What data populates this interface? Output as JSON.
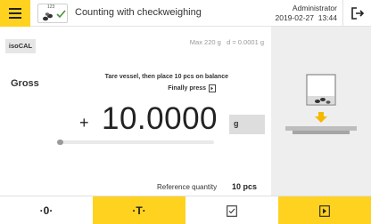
{
  "header": {
    "app_title": "Counting with checkweighing",
    "app_icon_superscript": "123",
    "user": "Administrator",
    "date": "2019-02-27",
    "time": "13:44"
  },
  "main": {
    "isocal_label": "isoCAL",
    "max_label": "Max 220 g",
    "d_label": "d = 0.0001 g",
    "mode": "Gross",
    "instruction_line1": "Tare vessel, then place 10 pcs on balance",
    "instruction_line2": "Finally press",
    "sign": "+",
    "weight_value": "10.0000",
    "unit": "g",
    "reference_label": "Reference quantity",
    "reference_value": "10 pcs"
  },
  "footer": {
    "zero_label": "·0·",
    "tare_label": "·T·"
  },
  "colors": {
    "accent": "#ffd21f",
    "side_panel": "#eeeeee",
    "arrow": "#f5b800"
  },
  "icons": {
    "menu": "hamburger-icon",
    "app": "counting-app-icon",
    "logout": "logout-icon",
    "accept": "checklist-icon",
    "finish": "document-arrow-icon",
    "illustration": "balance-with-vessel-illustration"
  }
}
